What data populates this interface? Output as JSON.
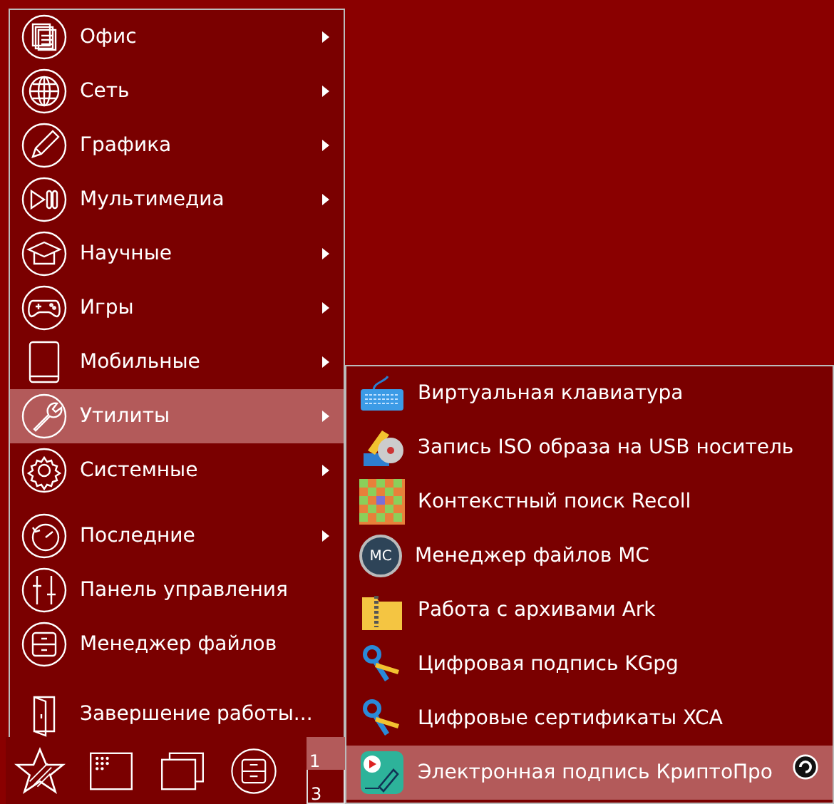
{
  "main_menu": {
    "items": [
      {
        "kind": "item",
        "label": "Офис",
        "submenu": true,
        "selected": false
      },
      {
        "kind": "item",
        "label": "Сеть",
        "submenu": true,
        "selected": false
      },
      {
        "kind": "item",
        "label": "Графика",
        "submenu": true,
        "selected": false
      },
      {
        "kind": "item",
        "label": "Мультимедиа",
        "submenu": true,
        "selected": false
      },
      {
        "kind": "item",
        "label": "Научные",
        "submenu": true,
        "selected": false
      },
      {
        "kind": "item",
        "label": "Игры",
        "submenu": true,
        "selected": false
      },
      {
        "kind": "item",
        "label": "Мобильные",
        "submenu": true,
        "selected": false
      },
      {
        "kind": "item",
        "label": "Утилиты",
        "submenu": true,
        "selected": true
      },
      {
        "kind": "item",
        "label": "Системные",
        "submenu": true,
        "selected": false
      },
      {
        "kind": "separator"
      },
      {
        "kind": "item",
        "label": "Последние",
        "submenu": true,
        "selected": false
      },
      {
        "kind": "item",
        "label": "Панель управления",
        "submenu": false,
        "selected": false
      },
      {
        "kind": "item",
        "label": "Менеджер файлов",
        "submenu": false,
        "selected": false
      },
      {
        "kind": "separator"
      },
      {
        "kind": "item",
        "label": "Завершение работы...",
        "submenu": false,
        "selected": false
      }
    ]
  },
  "submenu": {
    "items": [
      {
        "label": "Виртуальная клавиатура",
        "selected": false
      },
      {
        "label": "Запись ISO образа на USB носитель",
        "selected": false
      },
      {
        "label": "Контекстный поиск Recoll",
        "selected": false
      },
      {
        "label": "Менеджер файлов MC",
        "icon_text": "MC",
        "selected": false
      },
      {
        "label": "Работа с архивами Ark",
        "selected": false
      },
      {
        "label": "Цифровая подпись KGpg",
        "selected": false
      },
      {
        "label": "Цифровые сертификаты XCA",
        "selected": false
      },
      {
        "label": "Электронная подпись КриптоПро",
        "selected": true
      }
    ]
  },
  "taskbar": {
    "workspaces": [
      {
        "label": "1",
        "selected": true
      },
      {
        "label": "3",
        "selected": false
      }
    ]
  }
}
